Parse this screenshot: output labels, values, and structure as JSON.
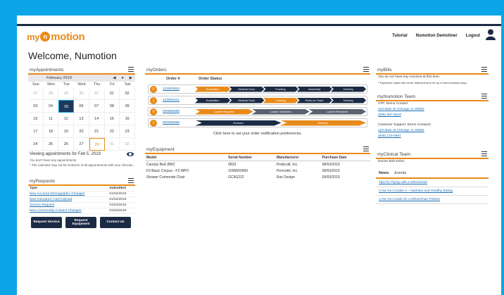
{
  "header": {
    "logo_pre": "my",
    "logo_mid": "n",
    "logo_post": "motion",
    "nav": [
      "Tutorial",
      "Numotion Demoliner",
      "Logout"
    ]
  },
  "welcome": "Welcome, Numotion",
  "appointments": {
    "title": "myAppointments",
    "month": "February 2019",
    "dow": [
      "Sun",
      "Mon",
      "Tue",
      "Wed",
      "Thu",
      "Fri",
      "Sat"
    ],
    "days": [
      {
        "d": "27",
        "o": true
      },
      {
        "d": "28",
        "o": true
      },
      {
        "d": "29",
        "o": true
      },
      {
        "d": "30",
        "o": true
      },
      {
        "d": "31",
        "o": true
      },
      {
        "d": "01"
      },
      {
        "d": "02"
      },
      {
        "d": "03"
      },
      {
        "d": "04"
      },
      {
        "d": "05",
        "sel": true
      },
      {
        "d": "06"
      },
      {
        "d": "07"
      },
      {
        "d": "08"
      },
      {
        "d": "09"
      },
      {
        "d": "10"
      },
      {
        "d": "11"
      },
      {
        "d": "12"
      },
      {
        "d": "13"
      },
      {
        "d": "14"
      },
      {
        "d": "15"
      },
      {
        "d": "16"
      },
      {
        "d": "17"
      },
      {
        "d": "18"
      },
      {
        "d": "19"
      },
      {
        "d": "20"
      },
      {
        "d": "21"
      },
      {
        "d": "22"
      },
      {
        "d": "23"
      },
      {
        "d": "24"
      },
      {
        "d": "25"
      },
      {
        "d": "26"
      },
      {
        "d": "27"
      },
      {
        "d": "28",
        "today": true
      },
      {
        "d": "01",
        "o": true
      },
      {
        "d": "02",
        "o": true
      }
    ],
    "viewing": "Viewing appointments for Feb 5, 2019",
    "none": "You don't have any appointments.",
    "note": "* The calendar may not be inclusive of all appointments with your clinician."
  },
  "requests": {
    "title": "myRequests",
    "headers": [
      "Type",
      "Submitted"
    ],
    "rows": [
      [
        "New Account Demographic Changes",
        "01/04/2019"
      ],
      [
        "New Insurance Card Upload",
        "01/04/2019"
      ],
      [
        "Service Request",
        "01/04/2019"
      ],
      [
        "New Community Contact Changes",
        "01/04/2019"
      ]
    ],
    "buttons": [
      "Request Service",
      "Request Equipment",
      "Contact Us"
    ]
  },
  "orders": {
    "title": "myOrders",
    "headers": [
      "Order #",
      "Order Status"
    ],
    "rows": [
      {
        "badge": "0",
        "badge_color": "#e88a1a",
        "num": "123923623",
        "steps": [
          {
            "l": "Evaluation",
            "c": "#e88a1a"
          },
          {
            "l": "Medical Docs",
            "c": "#1c2b44"
          },
          {
            "l": "Funding",
            "c": "#1c2b44"
          },
          {
            "l": "Assembly",
            "c": "#1c2b44"
          },
          {
            "l": "Delivery",
            "c": "#1c2b44"
          }
        ]
      },
      {
        "badge": "1",
        "badge_color": "#e88a1a",
        "num": "123905321",
        "steps": [
          {
            "l": "Evaluation",
            "c": "#1c2b44"
          },
          {
            "l": "Medical Docs",
            "c": "#1c2b44"
          },
          {
            "l": "Funding",
            "c": "#e88a1a"
          },
          {
            "l": "Parts on Order",
            "c": "#1c2b44"
          },
          {
            "l": "Delivery",
            "c": "#1c2b44"
          }
        ]
      },
      {
        "badge": "0",
        "badge_color": "#e88a1a",
        "num": "000555598",
        "steps": [
          {
            "l": "Loaner Request",
            "c": "#e88a1a"
          },
          {
            "l": "Loaner Delivered",
            "c": "#5a6270"
          },
          {
            "l": "Loaner Returned",
            "c": "#5a6270"
          }
        ]
      },
      {
        "badge": "1",
        "badge_color": "#e88a1a",
        "num": "000066666",
        "steps": [
          {
            "l": "Ordered",
            "c": "#1c2b44"
          },
          {
            "l": "Delivery",
            "c": "#e88a1a"
          }
        ]
      }
    ],
    "notif": "Click here to set your order notification preferences."
  },
  "equipment": {
    "title": "myEquipment",
    "headers": [
      "Model",
      "Serial Number",
      "Manufacturer",
      "Purchase Date"
    ],
    "rows": [
      [
        "Canopy Bed (BW)",
        "0833",
        "Pedicraft, Inc.",
        "08/03/2019"
      ],
      [
        "F3 Basic Corpus - F3 MPO",
        "1005660999",
        "Permobil, Inc.",
        "08/03/2019"
      ],
      [
        "Shower Commode Chair",
        "GC9G222",
        "Raz Design",
        "09/03/2019"
      ]
    ]
  },
  "bills": {
    "title": "myBills",
    "line1": "You do not have any invoices at this time.",
    "line2": "* Payments made will not be reflected here for up to five business days."
  },
  "team": {
    "title": "myNumotion Team",
    "atp_label": "ATP: Demo Contact",
    "atp_addr": "123 Main St Chicago, IL 60652",
    "atp_phone": "(608) 867-5543",
    "cs_label": "Customer Support: Demo Contact2",
    "cs_addr": "123 Main St Chicago, IL 60652",
    "cs_phone": "(608) 123-0987"
  },
  "clinical": {
    "title": "myClinical Team",
    "doctor": "Doctor Bob Kelso"
  },
  "news": {
    "tabs": [
      "News",
      "Events"
    ],
    "items": [
      "Tips for Flying with a Wheelchair",
      "A No You Cookie A – Nutrition and Healthy Eating",
      "A No You Guide for a Wheelchair Fitness"
    ]
  }
}
